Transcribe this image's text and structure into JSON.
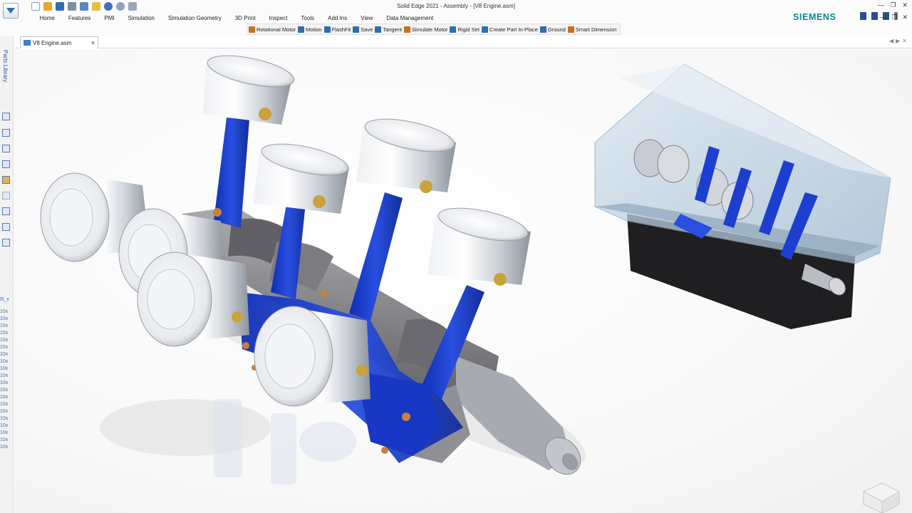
{
  "window": {
    "title": "Solid Edge 2021 - Assembly - [V8 Engine.asm]"
  },
  "brand": {
    "name": "SIEMENS",
    "color": "#0b8a8f"
  },
  "menu_tabs": [
    "Home",
    "Features",
    "PMI",
    "Simulation",
    "Simulation Geometry",
    "3D Print",
    "Inspect",
    "Tools",
    "Add Ins",
    "View",
    "Data Management"
  ],
  "command_bar": [
    {
      "label": "Rotational Motor",
      "icon": "rotational-motor-icon",
      "color": "#c8731a"
    },
    {
      "label": "Motion",
      "icon": "motion-icon",
      "color": "#2f6db5"
    },
    {
      "label": "FlashFit",
      "icon": "flashfit-icon",
      "color": "#2f6db5"
    },
    {
      "label": "Save",
      "icon": "save-icon",
      "color": "#2f6db5"
    },
    {
      "label": "Tangent",
      "icon": "tangent-icon",
      "color": "#2f6db5"
    },
    {
      "label": "Simulate Motor",
      "icon": "simulate-motor-icon",
      "color": "#c8731a"
    },
    {
      "label": "Rigid Set",
      "icon": "rigid-set-icon",
      "color": "#2f6db5"
    },
    {
      "label": "Create Part In-Place",
      "icon": "create-part-icon",
      "color": "#2f6db5"
    },
    {
      "label": "Ground",
      "icon": "ground-icon",
      "color": "#2f6db5"
    },
    {
      "label": "Smart Dimension",
      "icon": "smart-dimension-icon",
      "color": "#c8731a"
    }
  ],
  "left_rail": {
    "label": "Parts Library",
    "tree_text": [
      "l5_x",
      "10x",
      "10x",
      "10x",
      "10x",
      "10x",
      "10x",
      "10x",
      "10x",
      "10x",
      "10x",
      "10x",
      "10x",
      "10x",
      "10x",
      "10x",
      "10x",
      "10x",
      "10x",
      "10x",
      "10x"
    ]
  },
  "document_tab": {
    "label": "V8 Engine.asm",
    "close": "×"
  },
  "colors": {
    "rod_blue": "#1d3fd0",
    "piston_silver": "#d9dde2",
    "block_glass": "#b8cfe0",
    "crank_grey": "#6f6f73",
    "bushing_copper": "#c9803f"
  }
}
